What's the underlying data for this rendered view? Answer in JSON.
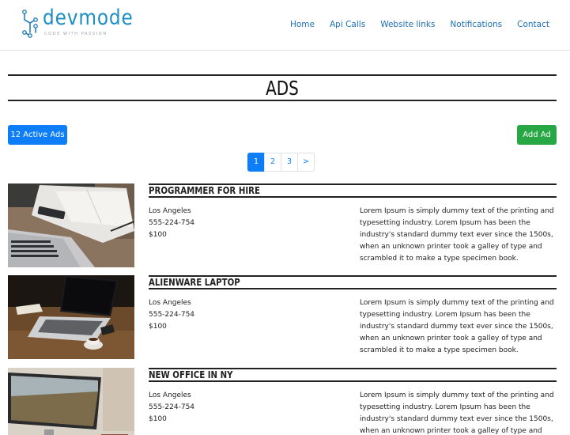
{
  "brand": {
    "name": "devmode",
    "tagline": "CODE WITH PASSION"
  },
  "nav": {
    "links": [
      "Home",
      "Api Calls",
      "Website links",
      "Notifications",
      "Contact"
    ]
  },
  "page": {
    "title": "ADS"
  },
  "toolbar": {
    "active_ads_label": "12 Active Ads",
    "add_ad_label": "Add Ad"
  },
  "pagination": {
    "pages": [
      "1",
      "2",
      "3",
      ">"
    ],
    "current": "1"
  },
  "ads": [
    {
      "title": "PROGRAMMER FOR HIRE",
      "location": "Los Angeles",
      "phone": "555-224-754",
      "price": "$100",
      "description": "Lorem Ipsum is simply dummy text of the printing and typesetting industry. Lorem Ipsum has been the industry's standard dummy text ever since the 1500s, when an unknown printer took a galley of type and scrambled it to make a type specimen book."
    },
    {
      "title": "ALIENWARE LAPTOP",
      "location": "Los Angeles",
      "phone": "555-224-754",
      "price": "$100",
      "description": "Lorem Ipsum is simply dummy text of the printing and typesetting industry. Lorem Ipsum has been the industry's standard dummy text ever since the 1500s, when an unknown printer took a galley of type and scrambled it to make a type specimen book."
    },
    {
      "title": "NEW OFFICE IN NY",
      "location": "Los Angeles",
      "phone": "555-224-754",
      "price": "$100",
      "description": "Lorem Ipsum is simply dummy text of the printing and typesetting industry. Lorem Ipsum has been the industry's standard dummy text ever since the 1500s, when an unknown printer took a galley of type and scrambled it to make a type specimen book."
    }
  ],
  "colors": {
    "primary": "#0d7ef8",
    "success": "#28a745",
    "brand": "#1d8fc2",
    "nav_link": "#1e6fb5"
  }
}
